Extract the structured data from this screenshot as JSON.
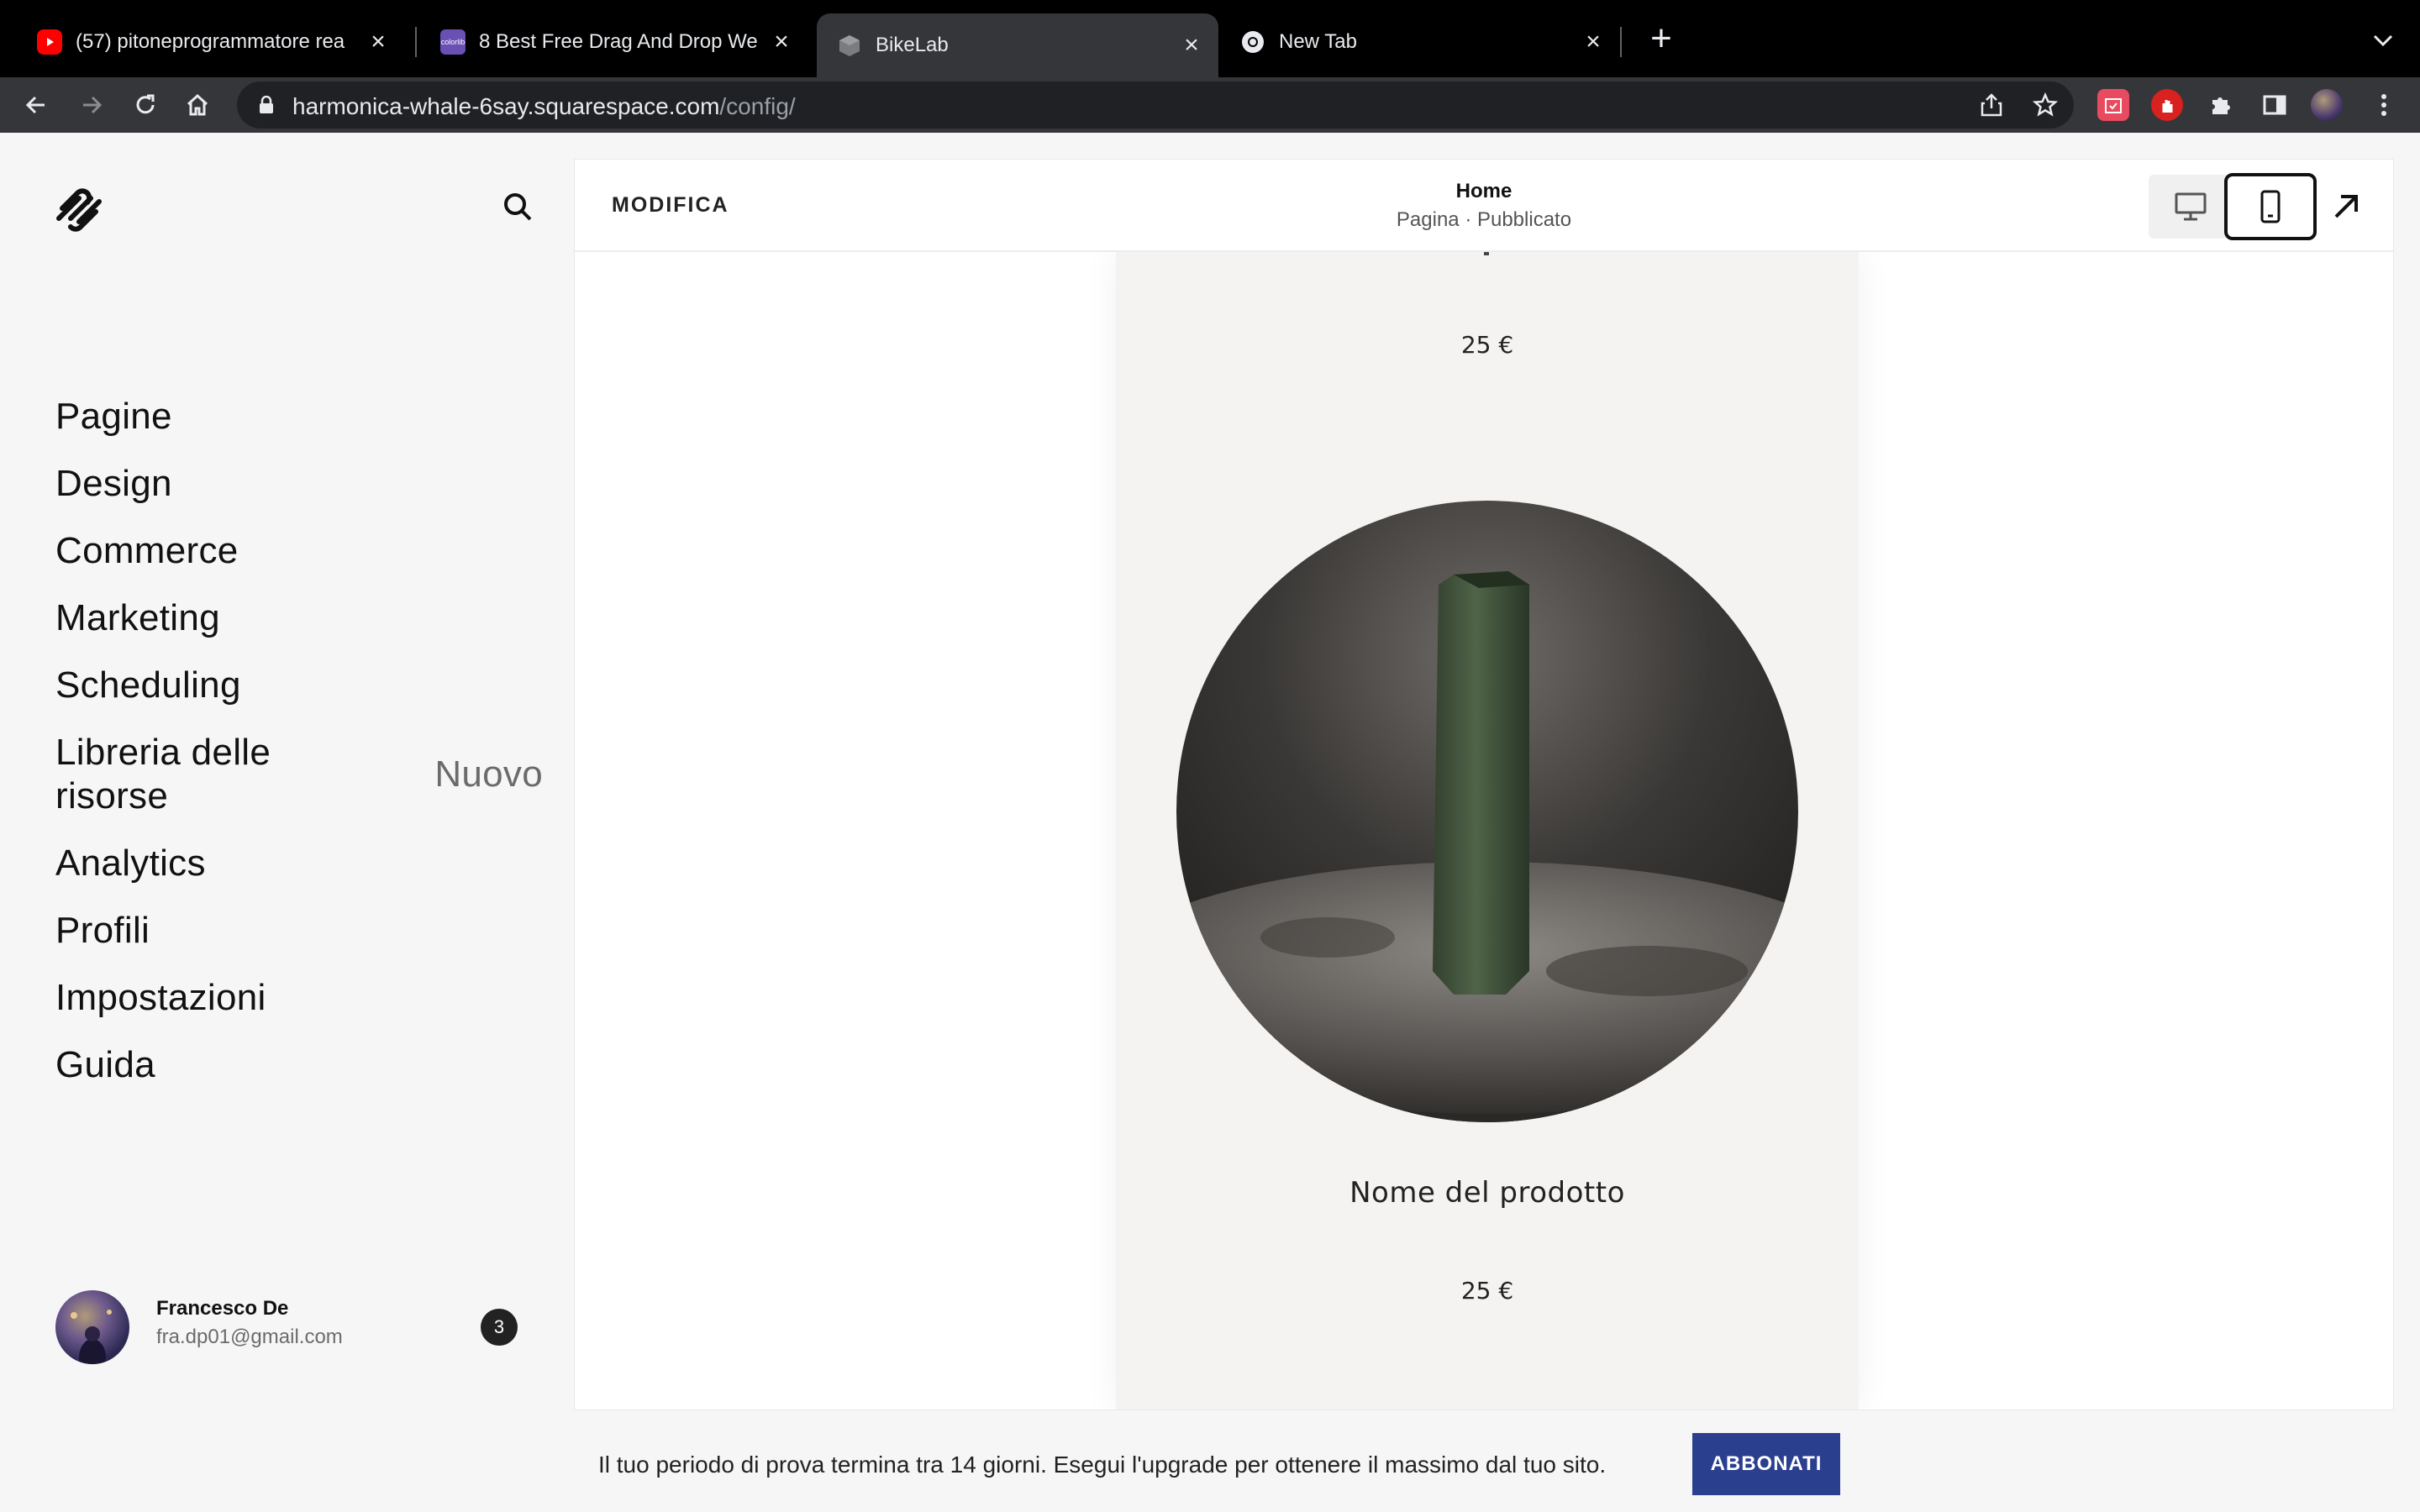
{
  "browser": {
    "tabs": [
      {
        "title": "(57) pitoneprogrammatore rea",
        "favicon": "youtube-icon"
      },
      {
        "title": "8 Best Free Drag And Drop We",
        "favicon": "colorlib-icon"
      },
      {
        "title": "BikeLab",
        "favicon": "cube-icon"
      },
      {
        "title": "New Tab",
        "favicon": "chrome-icon"
      }
    ],
    "url_host": "harmonica-whale-6say.squarespace.com",
    "url_path": "/config/"
  },
  "sidebar": {
    "nav": [
      {
        "label": "Pagine"
      },
      {
        "label": "Design"
      },
      {
        "label": "Commerce"
      },
      {
        "label": "Marketing"
      },
      {
        "label": "Scheduling"
      },
      {
        "label": "Libreria delle risorse",
        "badge": "Nuovo"
      },
      {
        "label": "Analytics"
      },
      {
        "label": "Profili"
      },
      {
        "label": "Impostazioni"
      },
      {
        "label": "Guida"
      }
    ],
    "user": {
      "name": "Francesco De",
      "email": "fra.dp01@gmail.com",
      "notifications": "3"
    }
  },
  "editor": {
    "edit_label": "MODIFICA",
    "page_title": "Home",
    "page_subtitle": "Pagina · Pubblicato"
  },
  "preview": {
    "top_price": "25 €",
    "product_name": "Nome del prodotto",
    "product_price": "25 €"
  },
  "trial": {
    "text": "Il tuo periodo di prova termina tra 14 giorni. Esegui l'upgrade per ottenere il massimo dal tuo sito.",
    "button": "ABBONATI"
  },
  "colors": {
    "accent": "#2b3f8f",
    "chrome_dark": "#35363a"
  }
}
